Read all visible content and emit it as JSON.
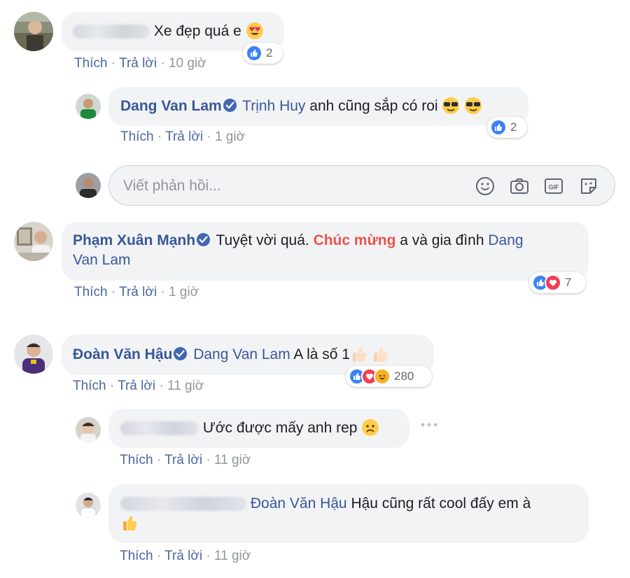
{
  "comments": [
    {
      "author": "",
      "text": "Xe đẹp quá e",
      "emoji": "heart-eyes-emoji",
      "reaction_count": "2",
      "actions": {
        "like": "Thích",
        "reply": "Trả lời",
        "time": "10 giờ"
      },
      "reply": {
        "author": "Dang Van Lam",
        "mention": "Trịnh Huy",
        "text": "anh cũng sắp có roi",
        "emoji": "sunglasses-emoji",
        "reaction_count": "2",
        "actions": {
          "like": "Thích",
          "reply": "Trả lời",
          "time": "1 giờ"
        }
      }
    },
    {
      "author": "Phạm Xuân Mạnh",
      "text_before": "Tuyệt vời quá.",
      "highlight": "Chúc mừng",
      "text_after": "a và gia đình",
      "mention_line1": "Dang",
      "mention_line2": "Van Lam",
      "reaction_count": "7",
      "actions": {
        "like": "Thích",
        "reply": "Trả lời",
        "time": "1 giờ"
      }
    },
    {
      "author": "Đoàn Văn Hậu",
      "mention": "Dang Van Lam",
      "text": "A là số 1",
      "reaction_count": "280",
      "actions": {
        "like": "Thích",
        "reply": "Trả lời",
        "time": "11 giờ"
      },
      "replies": [
        {
          "author": "",
          "text": "Ước được mấy anh rep",
          "actions": {
            "like": "Thích",
            "reply": "Trả lời",
            "time": "11 giờ"
          }
        },
        {
          "author": "",
          "mention": "Đoàn Văn Hậu",
          "text": "Hậu cũng rất cool đấy em à",
          "actions": {
            "like": "Thích",
            "reply": "Trả lời",
            "time": "11 giờ"
          }
        }
      ]
    }
  ],
  "reply_box": {
    "placeholder": "Viết phản hồi...",
    "tools": [
      "smiley-icon",
      "camera-icon",
      "gif-icon",
      "sticker-icon"
    ]
  },
  "separator": "·",
  "colors": {
    "bubble": "#f2f3f5",
    "name": "#385898",
    "link": "#4b67a1",
    "meta": "#90949c",
    "highlight": "#e9544c",
    "like": "#3b82f6",
    "love": "#f33e58",
    "haha": "#f7b125"
  }
}
